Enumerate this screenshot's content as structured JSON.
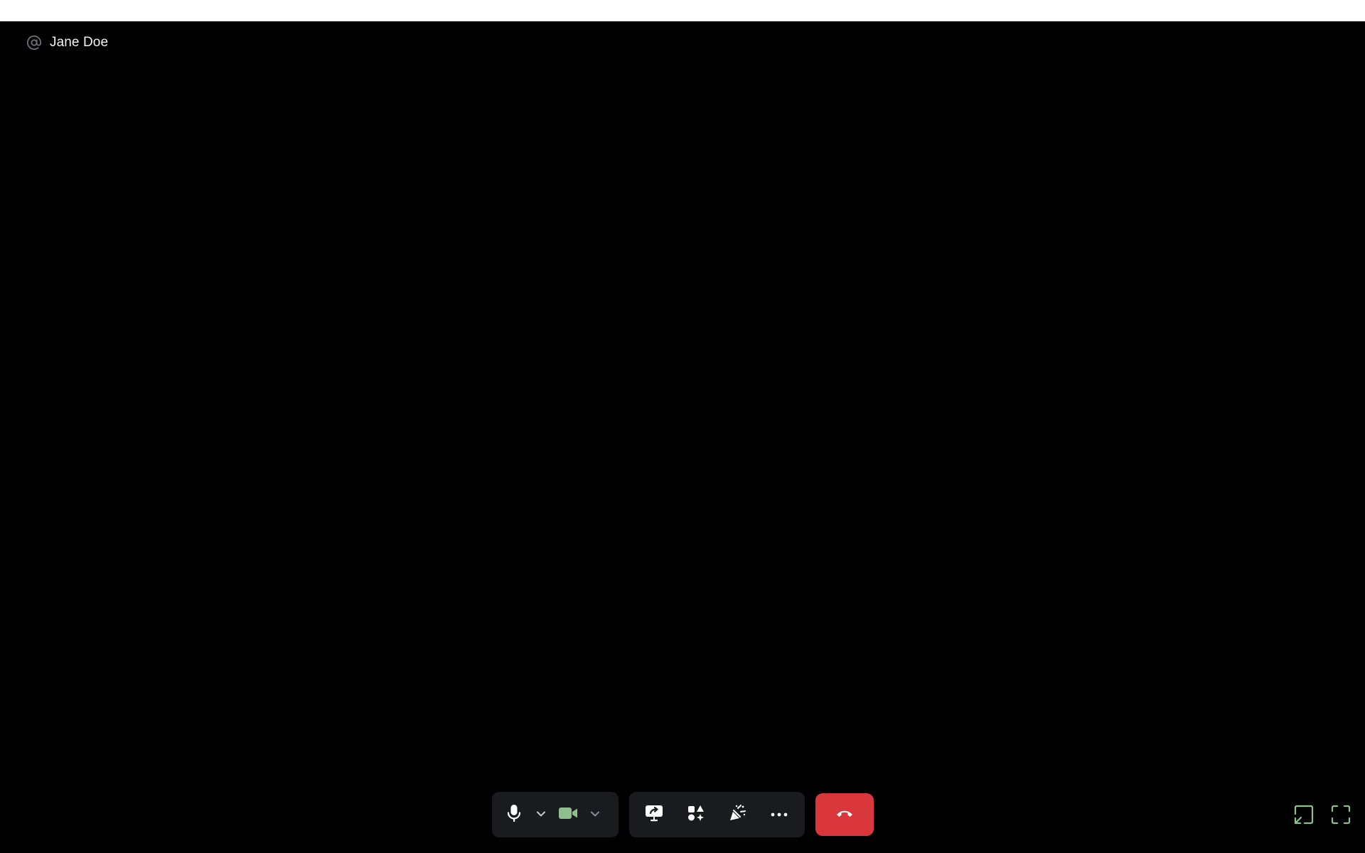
{
  "header": {
    "channel_name": "Jane Doe",
    "channel_icon": "at-icon"
  },
  "controls": {
    "microphone": {
      "icon": "microphone-icon",
      "active": true
    },
    "microphone_options": {
      "icon": "chevron-down-icon"
    },
    "camera": {
      "icon": "video-camera-icon",
      "active": true
    },
    "camera_options": {
      "icon": "chevron-down-icon"
    },
    "screen_share": {
      "icon": "screen-share-icon"
    },
    "activities": {
      "icon": "activities-icon"
    },
    "soundboard": {
      "icon": "soundboard-icon"
    },
    "more": {
      "icon": "more-icon"
    },
    "disconnect": {
      "icon": "hangup-icon"
    },
    "popout": {
      "icon": "popout-icon"
    },
    "fullscreen": {
      "icon": "fullscreen-icon"
    }
  },
  "colors": {
    "stage_background": "#000000",
    "control_group": "#1a1b1e",
    "hangup_red": "#da373c",
    "camera_green": "#8fbf8f",
    "corner_icon_green": "#8fbf8f",
    "at_icon_gray": "#6d6f78"
  }
}
